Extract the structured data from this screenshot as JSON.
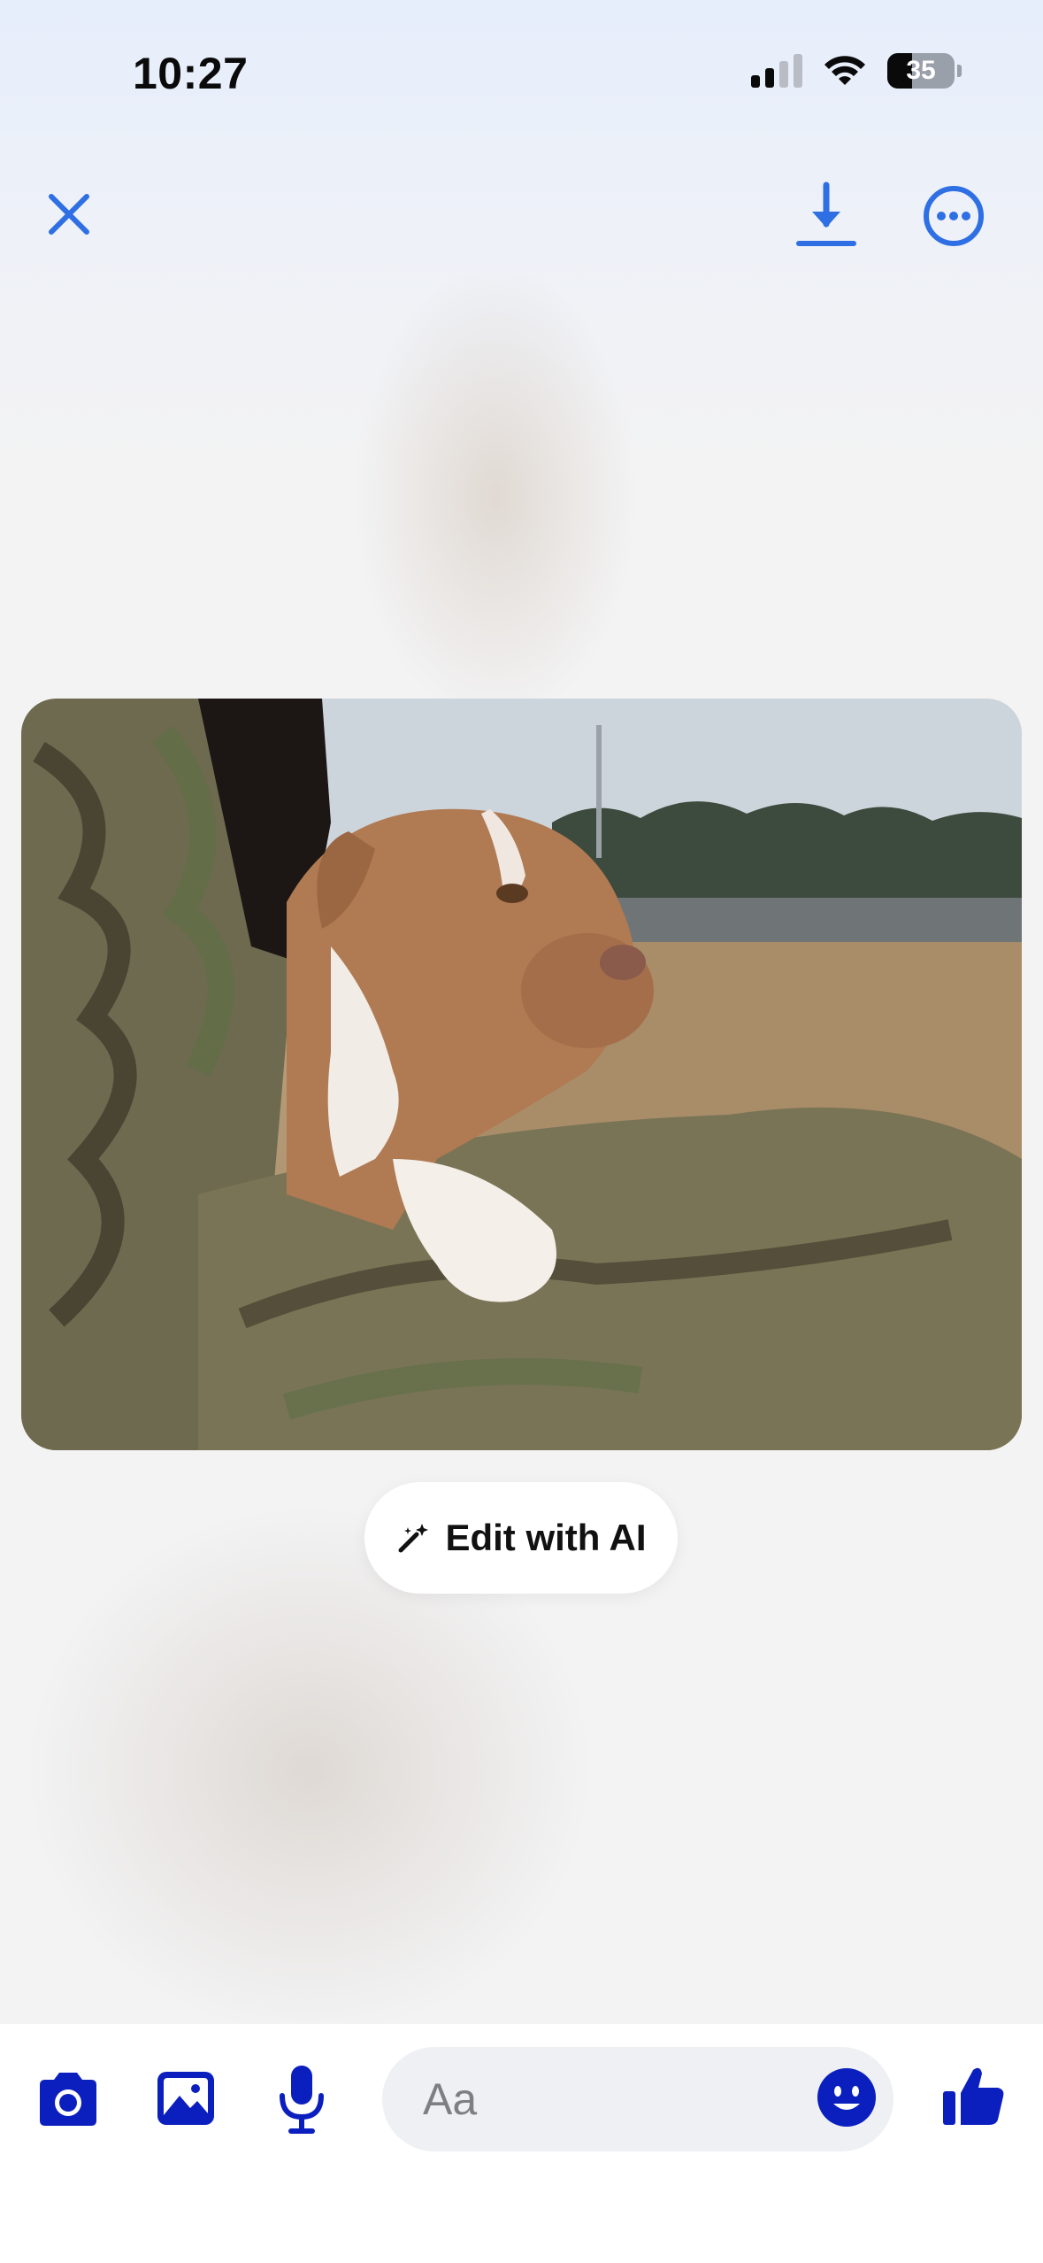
{
  "status_bar": {
    "time": "10:27",
    "battery_percent": "35",
    "signal_bars_active": 2,
    "wifi": "wifi-icon"
  },
  "top_bar": {
    "close_icon": "close-icon",
    "download_icon": "download-icon",
    "more_icon": "more-options-icon"
  },
  "photo": {
    "subject": "photo-dog"
  },
  "edit_ai": {
    "label": "Edit with AI",
    "icon": "magic-wand-icon"
  },
  "composer": {
    "placeholder": "Aa",
    "value": "",
    "icons": [
      "camera-icon",
      "gallery-icon",
      "microphone-icon",
      "emoji-icon",
      "like-icon"
    ]
  },
  "colors": {
    "accent_blue": "#2f6fe4",
    "composer_icon_blue": "#0b1fbf"
  }
}
